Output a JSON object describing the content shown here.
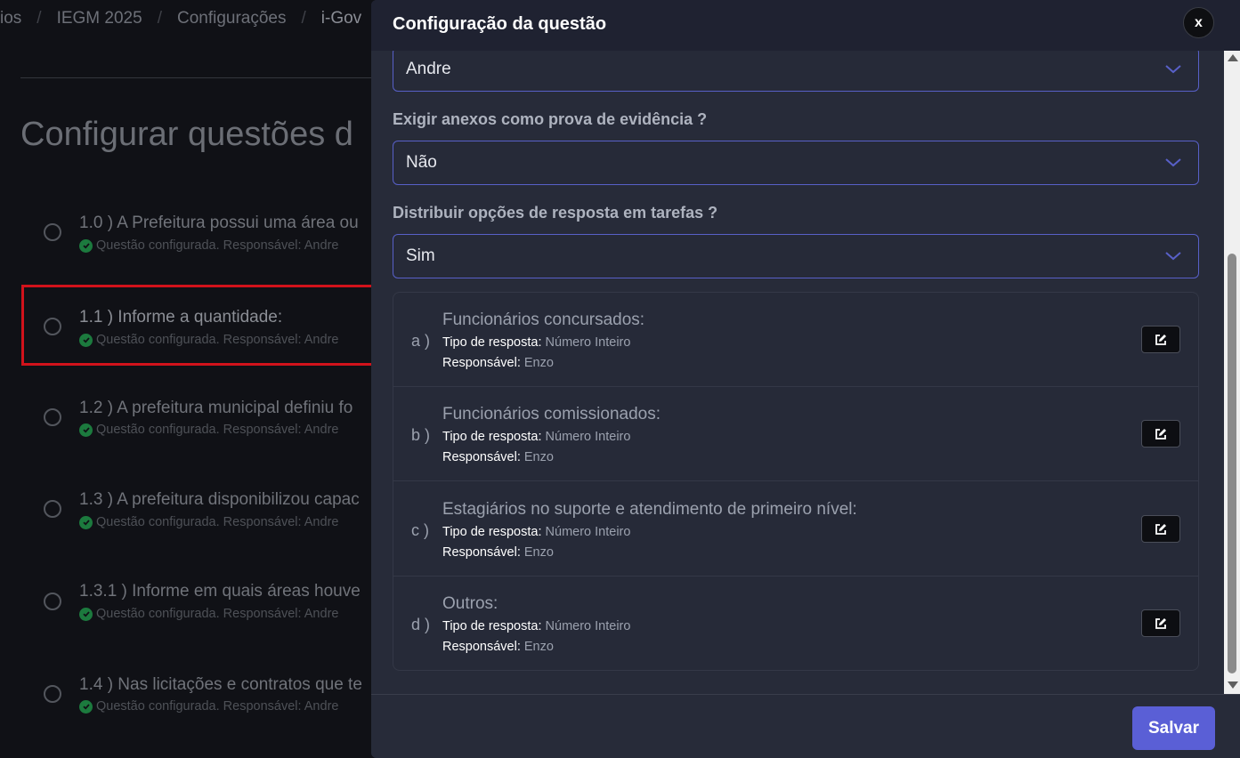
{
  "breadcrumb": [
    "ios",
    "IEGM 2025",
    "Configurações",
    "i-Gov"
  ],
  "page": {
    "title": "Configurar questões d",
    "questions": [
      {
        "title": "1.0 ) A Prefeitura possui uma área ou",
        "status": "Questão configurada. Responsável: Andre"
      },
      {
        "title": "1.1 ) Informe a quantidade:",
        "status": "Questão configurada. Responsável: Andre"
      },
      {
        "title": "1.2 ) A prefeitura municipal definiu fo",
        "status": "Questão configurada. Responsável: Andre"
      },
      {
        "title": "1.3 ) A prefeitura disponibilizou capac",
        "status": "Questão configurada. Responsável: Andre"
      },
      {
        "title": "1.3.1 ) Informe em quais áreas houve",
        "status": "Questão configurada. Responsável: Andre"
      },
      {
        "title": "1.4 ) Nas licitações e contratos que te",
        "status": "Questão configurada. Responsável: Andre"
      }
    ]
  },
  "modal": {
    "title": "Configuração da questão",
    "close_label": "x",
    "responsavel_value": "Andre",
    "exigir_label": "Exigir anexos como prova de evidência ?",
    "exigir_value": "Não",
    "distribuir_label": "Distribuir opções de resposta em tarefas ?",
    "distribuir_value": "Sim",
    "tipo_label": "Tipo de resposta:",
    "resp_label": "Responsável:",
    "options": [
      {
        "letter": "a )",
        "title": "Funcionários concursados:",
        "tipo": "Número Inteiro",
        "responsavel": "Enzo"
      },
      {
        "letter": "b )",
        "title": "Funcionários comissionados:",
        "tipo": "Número Inteiro",
        "responsavel": "Enzo"
      },
      {
        "letter": "c )",
        "title": "Estagiários no suporte e atendimento de primeiro nível:",
        "tipo": "Número Inteiro",
        "responsavel": "Enzo"
      },
      {
        "letter": "d )",
        "title": "Outros:",
        "tipo": "Número Inteiro",
        "responsavel": "Enzo"
      }
    ],
    "save_label": "Salvar"
  },
  "colors": {
    "accent": "#5a5fd6",
    "success": "#1c7a3e",
    "highlight": "#d1121b"
  },
  "icons": [
    "check-circle-icon",
    "chevron-down-icon",
    "edit-icon",
    "close-icon"
  ]
}
